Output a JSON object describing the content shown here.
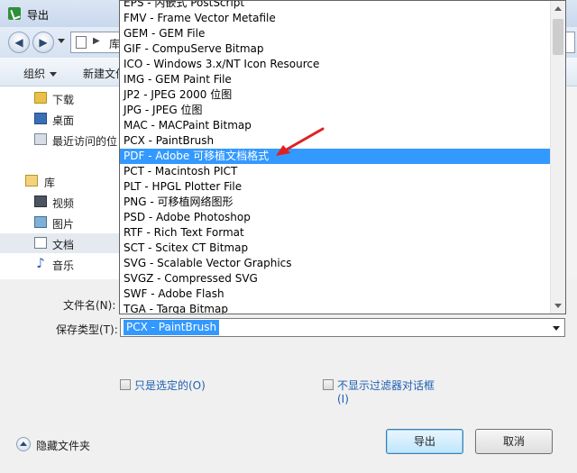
{
  "window": {
    "title": "导出"
  },
  "address": {
    "path": "库"
  },
  "toolbar": {
    "organize_label": "组织",
    "new_folder_label": "新建文件"
  },
  "nav": {
    "downloads": "下载",
    "desktop": "桌面",
    "recent": "最近访问的位",
    "library": "库",
    "videos": "视频",
    "pictures": "图片",
    "documents": "文档",
    "music": "音乐"
  },
  "dropdown": {
    "items": [
      "EPS - 内嵌式 PostScript",
      "FMV - Frame Vector Metafile",
      "GEM - GEM File",
      "GIF - CompuServe Bitmap",
      "ICO - Windows 3.x/NT Icon Resource",
      "IMG - GEM Paint File",
      "JP2 - JPEG 2000 位图",
      "JPG - JPEG 位图",
      "MAC - MACPaint Bitmap",
      "PCX - PaintBrush",
      "PDF - Adobe 可移植文档格式",
      "PCT - Macintosh PICT",
      "PLT - HPGL Plotter File",
      "PNG - 可移植网络图形",
      "PSD - Adobe Photoshop",
      "RTF - Rich Text Format",
      "SCT - Scitex CT Bitmap",
      "SVG - Scalable Vector Graphics",
      "SVGZ - Compressed SVG",
      "SWF - Adobe Flash",
      "TGA - Targa Bitmap"
    ],
    "selected_index": 10
  },
  "form": {
    "filename_label": "文件名(N):",
    "savetype_label": "保存类型(T):",
    "savetype_value": "PCX - PaintBrush"
  },
  "options": {
    "selected_only": "只是选定的(O)",
    "no_filter_dialog": "不显示过滤器对话框",
    "no_filter_dialog_key": "(I)"
  },
  "footer": {
    "hide_folders": "隐藏文件夹",
    "export": "导出",
    "cancel": "取消"
  },
  "colors": {
    "highlight": "#3399ff",
    "arrow": "#e02020",
    "link_text": "#1f5fb0"
  }
}
